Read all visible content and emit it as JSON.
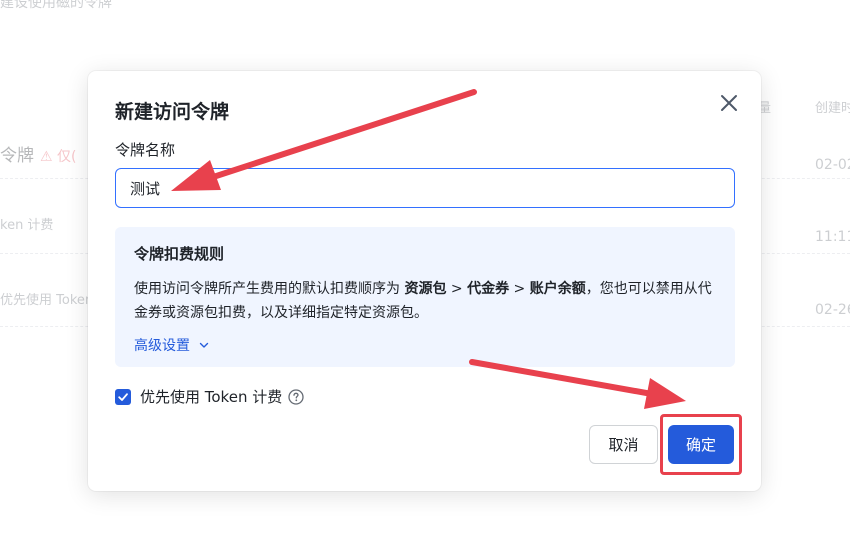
{
  "background": {
    "top_fragment": "建设使用磁的令牌",
    "token_fragment": "令牌",
    "warn_fragment": "⚠ 仅(",
    "row1_fragment": "ken 计费",
    "row2_fragment": "优先使用 Token",
    "col_fragment": "量",
    "col2_fragment": "创建时",
    "date1": "02-02",
    "date2": "11:11",
    "date3": "02-26"
  },
  "modal": {
    "title": "新建访问令牌",
    "name_label": "令牌名称",
    "name_value": "测试",
    "rules": {
      "title": "令牌扣费规则",
      "text_prefix": "使用访问令牌所产生费用的默认扣费顺序为 ",
      "order_1": "资源包",
      "sep_1": " > ",
      "order_2": "代金券",
      "sep_2": " > ",
      "order_3": "账户余额",
      "text_suffix": "，您也可以禁用从代金券或资源包扣费，以及详细指定特定资源包。",
      "advanced_link": "高级设置"
    },
    "checkbox_label": "优先使用 Token 计费",
    "checkbox_checked": true,
    "cancel_label": "取消",
    "confirm_label": "确定"
  },
  "colors": {
    "primary": "#245bdb",
    "annotation_red": "#e8414d",
    "rules_bg": "#f0f5ff"
  }
}
